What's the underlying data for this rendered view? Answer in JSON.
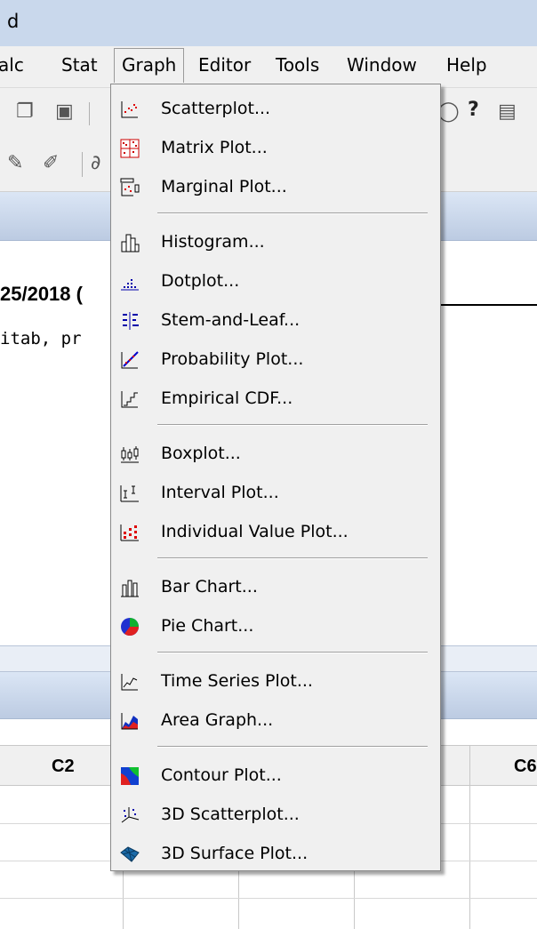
{
  "window": {
    "title_fragment": "d"
  },
  "menubar": {
    "items": [
      {
        "label": "alc"
      },
      {
        "label": "Stat"
      },
      {
        "label": "Graph"
      },
      {
        "label": "Editor"
      },
      {
        "label": "Tools"
      },
      {
        "label": "Window"
      },
      {
        "label": "Help"
      }
    ]
  },
  "session": {
    "date_fragment": "25/2018 (",
    "text_fragment": "itab, pr"
  },
  "worksheet": {
    "columns": [
      {
        "label": "C2"
      },
      {
        "label": "C6"
      }
    ]
  },
  "graph_menu": {
    "items": [
      {
        "label": "Scatterplot...",
        "icon": "scatterplot-icon"
      },
      {
        "label": "Matrix Plot...",
        "icon": "matrix-plot-icon"
      },
      {
        "label": "Marginal Plot...",
        "icon": "marginal-plot-icon"
      },
      {
        "label": "Histogram...",
        "icon": "histogram-icon"
      },
      {
        "label": "Dotplot...",
        "icon": "dotplot-icon"
      },
      {
        "label": "Stem-and-Leaf...",
        "icon": "stem-and-leaf-icon"
      },
      {
        "label": "Probability Plot...",
        "icon": "probability-plot-icon"
      },
      {
        "label": "Empirical CDF...",
        "icon": "empirical-cdf-icon"
      },
      {
        "label": "Boxplot...",
        "icon": "boxplot-icon"
      },
      {
        "label": "Interval Plot...",
        "icon": "interval-plot-icon"
      },
      {
        "label": "Individual Value Plot...",
        "icon": "individual-value-plot-icon"
      },
      {
        "label": "Bar Chart...",
        "icon": "bar-chart-icon"
      },
      {
        "label": "Pie Chart...",
        "icon": "pie-chart-icon"
      },
      {
        "label": "Time Series Plot...",
        "icon": "time-series-plot-icon"
      },
      {
        "label": "Area Graph...",
        "icon": "area-graph-icon"
      },
      {
        "label": "Contour Plot...",
        "icon": "contour-plot-icon"
      },
      {
        "label": "3D Scatterplot...",
        "icon": "3d-scatterplot-icon"
      },
      {
        "label": "3D Surface Plot...",
        "icon": "3d-surface-plot-icon"
      }
    ]
  }
}
